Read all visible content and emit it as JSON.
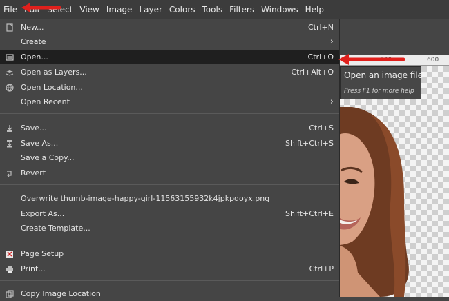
{
  "menubar": {
    "items": [
      "File",
      "Edit",
      "Select",
      "View",
      "Image",
      "Layer",
      "Colors",
      "Tools",
      "Filters",
      "Windows",
      "Help"
    ]
  },
  "file_menu": {
    "new": {
      "label": "New...",
      "shortcut": "Ctrl+N"
    },
    "create": {
      "label": "Create"
    },
    "open": {
      "label": "Open...",
      "shortcut": "Ctrl+O"
    },
    "open_as_layers": {
      "label": "Open as Layers...",
      "shortcut": "Ctrl+Alt+O"
    },
    "open_location": {
      "label": "Open Location..."
    },
    "open_recent": {
      "label": "Open Recent"
    },
    "save": {
      "label": "Save...",
      "shortcut": "Ctrl+S"
    },
    "save_as": {
      "label": "Save As...",
      "shortcut": "Shift+Ctrl+S"
    },
    "save_copy": {
      "label": "Save a Copy..."
    },
    "revert": {
      "label": "Revert"
    },
    "overwrite": {
      "label": "Overwrite thumb-image-happy-girl-11563155932k4jpkpdoyx.png"
    },
    "export_as": {
      "label": "Export As...",
      "shortcut": "Shift+Ctrl+E"
    },
    "create_template": {
      "label": "Create Template..."
    },
    "page_setup": {
      "label": "Page Setup"
    },
    "print": {
      "label": "Print...",
      "shortcut": "Ctrl+P"
    },
    "copy_image_location": {
      "label": "Copy Image Location"
    }
  },
  "tooltip": {
    "title": "Open an image file",
    "hint": "Press F1 for more help"
  },
  "ruler": {
    "tick1": "500",
    "tick2": "600"
  },
  "colors": {
    "annotation_arrow": "#e0201c",
    "highlight": "#1f1f1f",
    "menu_bg": "#454545"
  }
}
